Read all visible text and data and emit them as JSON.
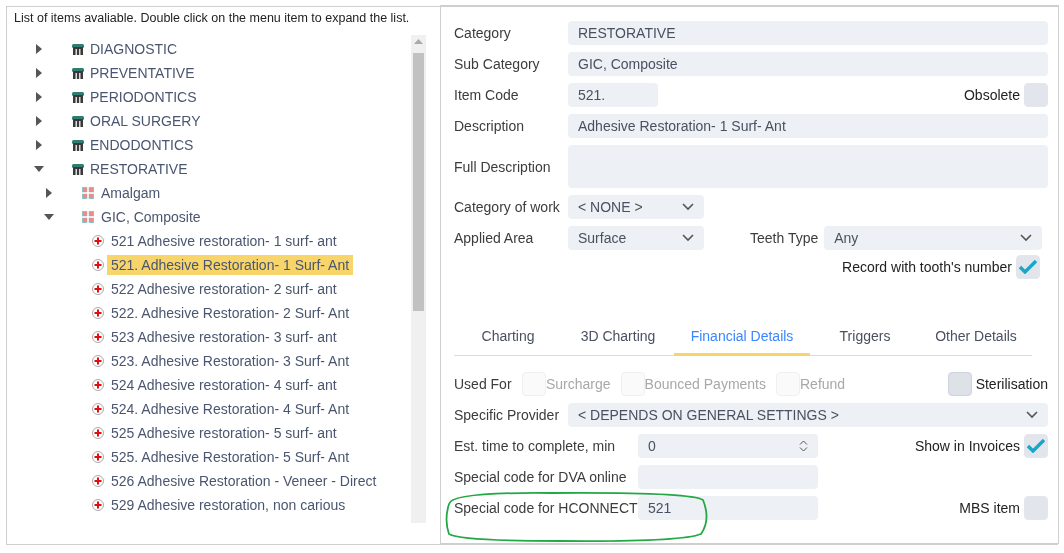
{
  "hint": "List of items avaliable. Double click on the menu item to expand the list.",
  "tree": [
    {
      "kind": "category",
      "label": "DIAGNOSTIC",
      "expanded": false,
      "selected": false
    },
    {
      "kind": "category",
      "label": "PREVENTATIVE",
      "expanded": false,
      "selected": false
    },
    {
      "kind": "category",
      "label": "PERIODONTICS",
      "expanded": false,
      "selected": false
    },
    {
      "kind": "category",
      "label": "ORAL SURGERY",
      "expanded": false,
      "selected": false
    },
    {
      "kind": "category",
      "label": "ENDODONTICS",
      "expanded": false,
      "selected": false
    },
    {
      "kind": "category",
      "label": "RESTORATIVE",
      "expanded": true,
      "selected": false,
      "children": [
        {
          "kind": "subcategory",
          "label": "Amalgam",
          "expanded": false,
          "selected": false
        },
        {
          "kind": "subcategory",
          "label": "GIC, Composite",
          "expanded": true,
          "selected": false,
          "children": [
            {
              "kind": "item",
              "label": "521 Adhesive restoration- 1 surf- ant",
              "selected": false
            },
            {
              "kind": "item",
              "label": "521. Adhesive Restoration- 1 Surf- Ant",
              "selected": true
            },
            {
              "kind": "item",
              "label": "522 Adhesive restoration- 2 surf- ant",
              "selected": false
            },
            {
              "kind": "item",
              "label": "522. Adhesive Restoration- 2 Surf- Ant",
              "selected": false
            },
            {
              "kind": "item",
              "label": "523 Adhesive restoration- 3 surf- ant",
              "selected": false
            },
            {
              "kind": "item",
              "label": "523. Adhesive Restoration- 3 Surf- Ant",
              "selected": false
            },
            {
              "kind": "item",
              "label": "524 Adhesive restoration- 4 surf- ant",
              "selected": false
            },
            {
              "kind": "item",
              "label": "524. Adhesive Restoration- 4 Surf- Ant",
              "selected": false
            },
            {
              "kind": "item",
              "label": "525 Adhesive restoration- 5 surf- ant",
              "selected": false
            },
            {
              "kind": "item",
              "label": "525. Adhesive Restoration- 5 Surf- Ant",
              "selected": false
            },
            {
              "kind": "item",
              "label": "526 Adhesive Restoration - Veneer - Direct",
              "selected": false
            },
            {
              "kind": "item",
              "label": "529 Adhesive restoration, non carious",
              "selected": false
            }
          ]
        }
      ]
    }
  ],
  "form": {
    "category": {
      "label": "Category",
      "value": "RESTORATIVE"
    },
    "sub_category": {
      "label": "Sub Category",
      "value": "GIC, Composite"
    },
    "item_code": {
      "label": "Item Code",
      "value": "521."
    },
    "obsolete": {
      "label": "Obsolete",
      "checked": false
    },
    "description": {
      "label": "Description",
      "value": "Adhesive Restoration- 1 Surf- Ant"
    },
    "full_description": {
      "label": "Full Description"
    },
    "category_of_work": {
      "label": "Category of work",
      "value": "< NONE >"
    },
    "applied_area": {
      "label": "Applied Area",
      "value": "Surface"
    },
    "teeth_type": {
      "label": "Teeth Type",
      "value": "Any"
    },
    "record_with_tooth_number": {
      "label": "Record with tooth's number",
      "checked": true
    }
  },
  "tabs": [
    {
      "label": "Charting",
      "selected": false
    },
    {
      "label": "3D Charting",
      "selected": false
    },
    {
      "label": "Financial Details",
      "selected": true
    },
    {
      "label": "Triggers",
      "selected": false
    },
    {
      "label": "Other Details",
      "selected": false
    }
  ],
  "financial": {
    "used_for": {
      "label": "Used For",
      "options": [
        {
          "label": "Surcharge",
          "checked": false,
          "disabled": true
        },
        {
          "label": "Bounced Payments",
          "checked": false,
          "disabled": true
        },
        {
          "label": "Refund",
          "checked": false,
          "disabled": true
        },
        {
          "label": "Sterilisation",
          "checked": false,
          "disabled": false
        }
      ]
    },
    "specific_provider": {
      "label": "Specific Provider",
      "value": "< DEPENDS ON GENERAL SETTINGS >"
    },
    "est_time": {
      "label": "Est. time to complete, min",
      "value": "0"
    },
    "show_in_invoices": {
      "label": "Show in Invoices",
      "checked": true
    },
    "dva_code": {
      "label": "Special code for DVA online"
    },
    "hconnect_code": {
      "label": "Special code for HCONNECT",
      "value": "521",
      "highlighted": true
    },
    "mbs_item": {
      "label": "MBS item",
      "checked": false
    }
  }
}
